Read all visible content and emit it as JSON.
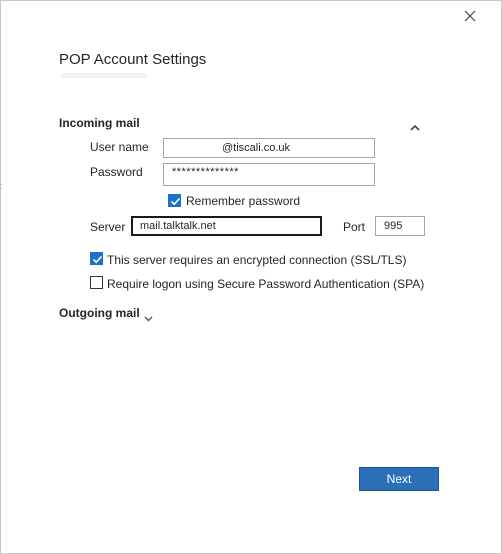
{
  "dialog": {
    "title": "POP Account Settings"
  },
  "incoming": {
    "header": "Incoming mail",
    "username_label": "User name",
    "username_value": "@tiscali.co.uk",
    "password_label": "Password",
    "password_value": "**************",
    "remember_label": "Remember password",
    "remember_checked": true,
    "server_label": "Server",
    "server_value": "mail.talktalk.net",
    "port_label": "Port",
    "port_value": "995",
    "ssl_label": "This server requires an encrypted connection (SSL/TLS)",
    "ssl_checked": true,
    "spa_label": "Require logon using Secure Password Authentication (SPA)",
    "spa_checked": false
  },
  "outgoing": {
    "header": "Outgoing mail"
  },
  "footer": {
    "next_label": "Next"
  },
  "colors": {
    "accent": "#2b6fb6",
    "checkbox": "#1a73c8"
  }
}
